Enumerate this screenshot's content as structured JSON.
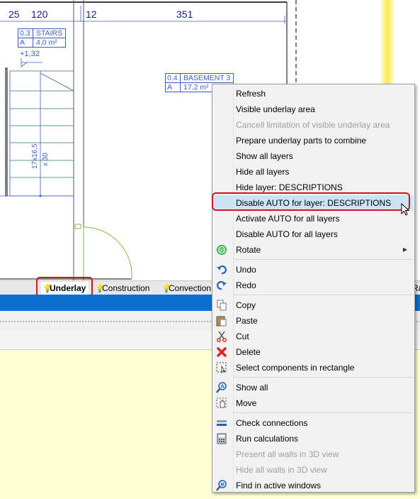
{
  "drawing": {
    "dimensions": [
      "25",
      "120",
      "12",
      "351"
    ],
    "stairs_tag": {
      "number": "0.3",
      "name": "STAIRS",
      "area_code": "A",
      "area": "4,0 m²"
    },
    "basement_tag": {
      "number": "0.4",
      "name": "BASEMENT 3",
      "area_code": "A",
      "area": "17,2 m²"
    },
    "level_mark": "+1,32",
    "stair_dim": "17x16,5",
    "stair_count": "x 30"
  },
  "tabs": [
    {
      "label": "Underlay",
      "active": true
    },
    {
      "label": "Construction",
      "active": false
    },
    {
      "label": "Convection",
      "active": false
    },
    {
      "label": "Ra",
      "active": false
    }
  ],
  "menu": {
    "items": [
      {
        "label": "Refresh",
        "enabled": true,
        "icon": ""
      },
      {
        "label": "Visible underlay area",
        "enabled": true,
        "icon": ""
      },
      {
        "label": "Cancell limitation of visible underlay area",
        "enabled": false,
        "icon": ""
      },
      {
        "label": "Prepare underlay parts to combine",
        "enabled": true,
        "icon": ""
      },
      {
        "label": "Show all layers",
        "enabled": true,
        "icon": ""
      },
      {
        "label": "Hide all layers",
        "enabled": true,
        "icon": ""
      },
      {
        "label": "Hide layer: DESCRIPTIONS",
        "enabled": true,
        "icon": ""
      },
      {
        "label": "Disable AUTO for layer: DESCRIPTIONS",
        "enabled": true,
        "icon": "",
        "hover": true
      },
      {
        "label": "Activate AUTO for all layers",
        "enabled": true,
        "icon": ""
      },
      {
        "label": "Disable AUTO for all layers",
        "enabled": true,
        "icon": ""
      },
      {
        "label": "Rotate",
        "enabled": true,
        "icon": "rotate-icon",
        "submenu": true
      },
      {
        "label": "Undo",
        "enabled": true,
        "icon": "undo-icon"
      },
      {
        "label": "Redo",
        "enabled": true,
        "icon": "redo-icon"
      },
      {
        "label": "Copy",
        "enabled": true,
        "icon": "copy-icon"
      },
      {
        "label": "Paste",
        "enabled": true,
        "icon": "paste-icon"
      },
      {
        "label": "Cut",
        "enabled": true,
        "icon": "cut-icon"
      },
      {
        "label": "Delete",
        "enabled": true,
        "icon": "delete-icon"
      },
      {
        "label": "Select components in rectangle",
        "enabled": true,
        "icon": "select-rectangle-icon"
      },
      {
        "label": "Show all",
        "enabled": true,
        "icon": "zoom-all-icon"
      },
      {
        "label": "Move",
        "enabled": true,
        "icon": "pan-icon"
      },
      {
        "label": "Check connections",
        "enabled": true,
        "icon": "check-connections-icon"
      },
      {
        "label": "Run calculations",
        "enabled": true,
        "icon": "calculator-icon"
      },
      {
        "label": "Present all walls in 3D view",
        "enabled": false,
        "icon": ""
      },
      {
        "label": "Hide all walls in 3D view",
        "enabled": false,
        "icon": ""
      },
      {
        "label": "Find in active windows",
        "enabled": true,
        "icon": "find-icon"
      }
    ]
  },
  "colors": {
    "highlight": "#d2141e",
    "accent_blue": "#0b6fd0",
    "menu_hover": "#cde4f7"
  }
}
